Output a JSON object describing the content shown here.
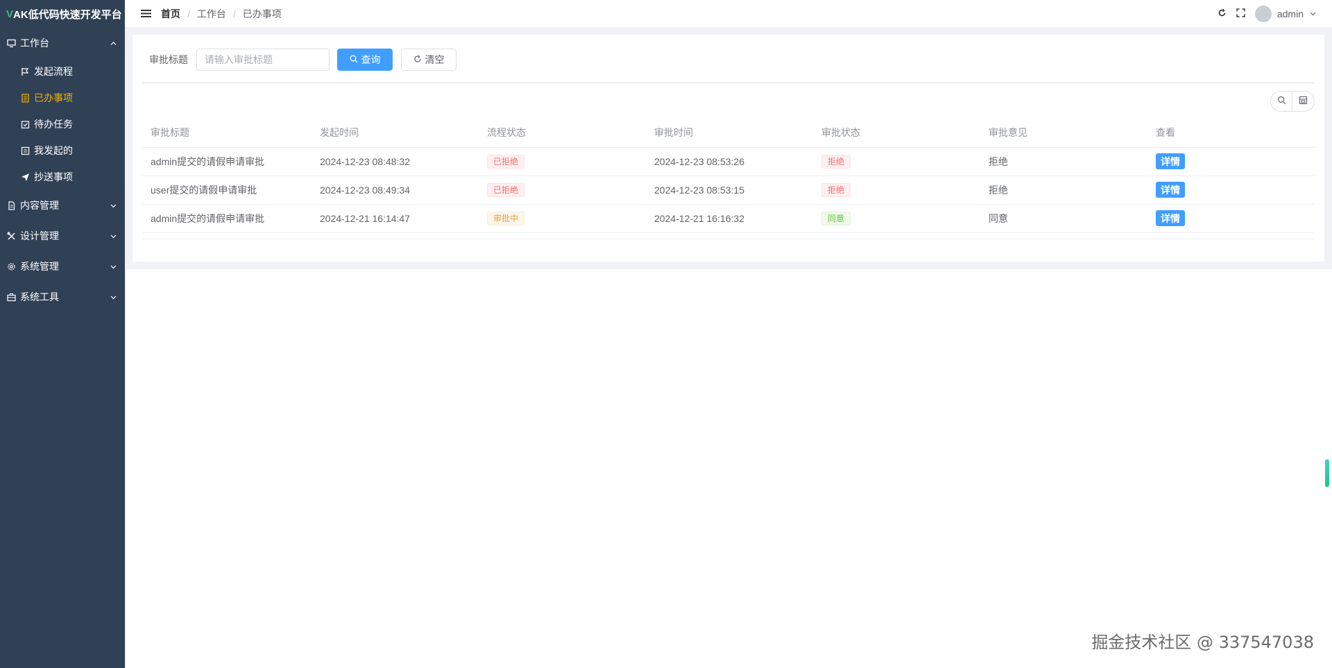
{
  "app": {
    "logo_v": "V",
    "logo_rest": "AK低代码快速开发平台"
  },
  "sidebar": {
    "groups": [
      {
        "label": "工作台",
        "icon": "monitor-icon",
        "expanded": true,
        "items": [
          {
            "label": "发起流程",
            "icon": "flag-icon"
          },
          {
            "label": "已办事项",
            "icon": "document-icon",
            "active": true
          },
          {
            "label": "待办任务",
            "icon": "calendar-check-icon"
          },
          {
            "label": "我发起的",
            "icon": "list-icon"
          },
          {
            "label": "抄送事项",
            "icon": "send-icon"
          }
        ]
      },
      {
        "label": "内容管理",
        "icon": "file-icon",
        "expanded": false
      },
      {
        "label": "设计管理",
        "icon": "tools-icon",
        "expanded": false
      },
      {
        "label": "系统管理",
        "icon": "gear-icon",
        "expanded": false
      },
      {
        "label": "系统工具",
        "icon": "toolbox-icon",
        "expanded": false
      }
    ]
  },
  "navbar": {
    "breadcrumb": [
      "首页",
      "工作台",
      "已办事项"
    ],
    "user": "admin"
  },
  "search": {
    "label": "审批标题",
    "placeholder": "请输入审批标题",
    "query_label": "查询",
    "clear_label": "清空"
  },
  "table": {
    "headers": [
      "审批标题",
      "发起时间",
      "流程状态",
      "审批时间",
      "审批状态",
      "审批意见",
      "查看"
    ],
    "rows": [
      {
        "title": "admin提交的请假申请审批",
        "start": "2024-12-23 08:48:32",
        "flow_status": "已拒绝",
        "flow_type": "danger",
        "approve_time": "2024-12-23 08:53:26",
        "approve_status": "拒绝",
        "approve_type": "danger",
        "opinion": "拒绝",
        "action": "详情"
      },
      {
        "title": "user提交的请假申请审批",
        "start": "2024-12-23 08:49:34",
        "flow_status": "已拒绝",
        "flow_type": "danger",
        "approve_time": "2024-12-23 08:53:15",
        "approve_status": "拒绝",
        "approve_type": "danger",
        "opinion": "拒绝",
        "action": "详情"
      },
      {
        "title": "admin提交的请假申请审批",
        "start": "2024-12-21 16:14:47",
        "flow_status": "审批中",
        "flow_type": "warning",
        "approve_time": "2024-12-21 16:16:32",
        "approve_status": "同意",
        "approve_type": "success",
        "opinion": "同意",
        "action": "详情"
      }
    ]
  },
  "watermark": "掘金技术社区 @ 337547038",
  "colors": {
    "sidebar_bg": "#304156",
    "active": "#f4b400",
    "primary": "#409eff"
  }
}
